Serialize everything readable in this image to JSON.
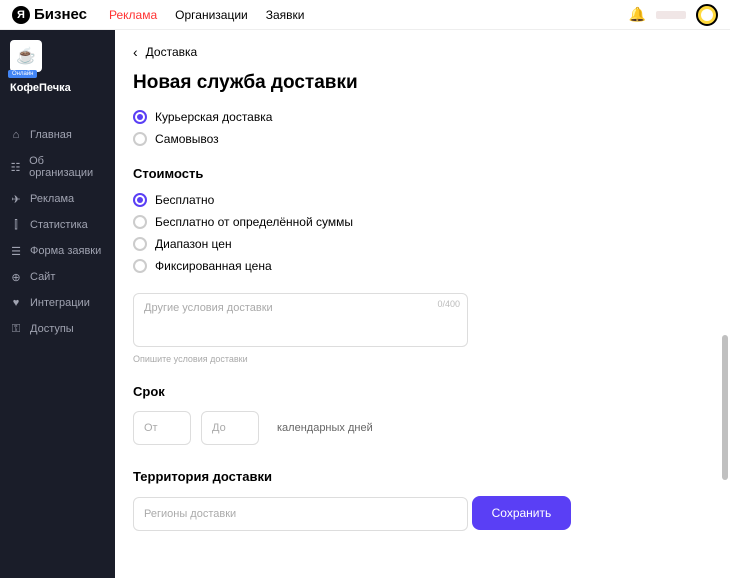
{
  "header": {
    "logo_text": "Бизнес",
    "tabs": [
      {
        "label": "Реклама",
        "active": true
      },
      {
        "label": "Организации",
        "active": false
      },
      {
        "label": "Заявки",
        "active": false
      }
    ]
  },
  "sidebar": {
    "company_name": "КофеПечка",
    "company_badge": "Онлайн",
    "items": [
      {
        "icon": "⌂",
        "label": "Главная"
      },
      {
        "icon": "☷",
        "label": "Об организации"
      },
      {
        "icon": "✈",
        "label": "Реклама"
      },
      {
        "icon": "⫿",
        "label": "Статистика"
      },
      {
        "icon": "☰",
        "label": "Форма заявки"
      },
      {
        "icon": "⊕",
        "label": "Сайт"
      },
      {
        "icon": "♥",
        "label": "Интеграции"
      },
      {
        "icon": "⚿",
        "label": "Доступы"
      }
    ]
  },
  "main": {
    "breadcrumb": "Доставка",
    "title": "Новая служба доставки",
    "delivery_type": {
      "options": [
        {
          "label": "Курьерская доставка",
          "selected": true
        },
        {
          "label": "Самовывоз",
          "selected": false
        }
      ]
    },
    "cost": {
      "title": "Стоимость",
      "options": [
        {
          "label": "Бесплатно",
          "selected": true
        },
        {
          "label": "Бесплатно от определённой суммы",
          "selected": false
        },
        {
          "label": "Диапазон цен",
          "selected": false
        },
        {
          "label": "Фиксированная цена",
          "selected": false
        }
      ]
    },
    "conditions": {
      "placeholder": "Другие условия доставки",
      "char_count": "0/400",
      "hint": "Опишите условия доставки"
    },
    "period": {
      "title": "Срок",
      "from_placeholder": "От",
      "to_placeholder": "До",
      "unit_label": "календарных дней"
    },
    "territory": {
      "title": "Территория доставки",
      "placeholder": "Регионы доставки"
    },
    "save_button": "Сохранить"
  }
}
